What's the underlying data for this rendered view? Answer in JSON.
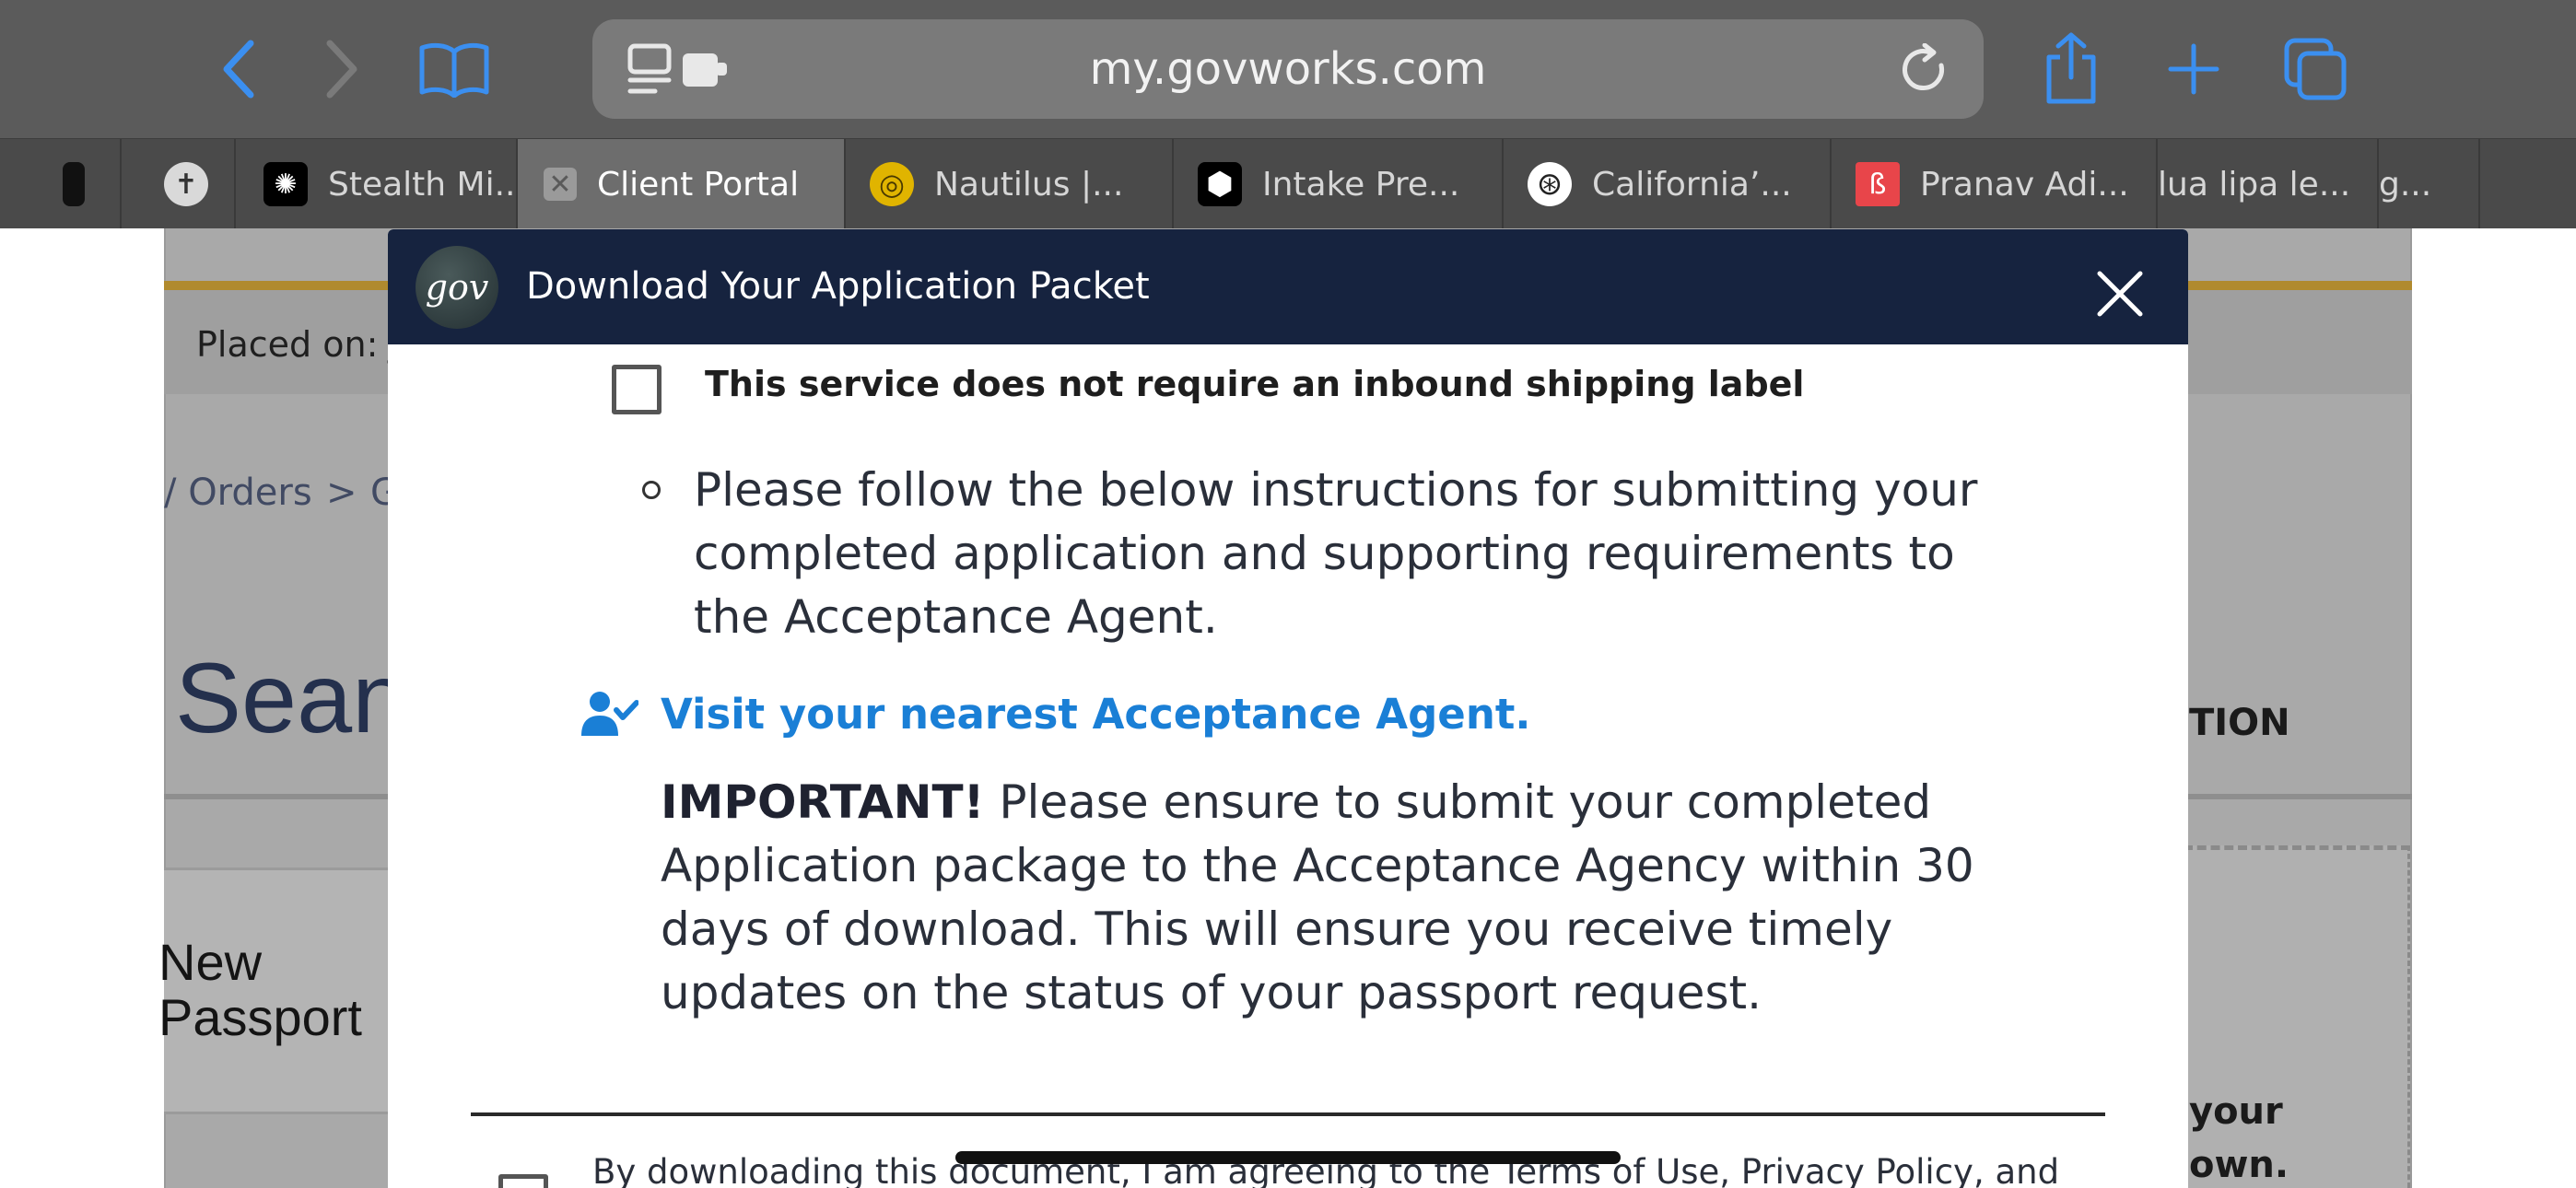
{
  "browser": {
    "url": "my.govworks.com",
    "tabs": [
      {
        "label": "",
        "icon": "dark-favicon"
      },
      {
        "label": "",
        "icon": "cross-favicon"
      },
      {
        "label": "Stealth Mi...",
        "icon": "spider-favicon"
      },
      {
        "label": "Client Portal",
        "icon": "close-icon",
        "active": true
      },
      {
        "label": "Nautilus |...",
        "icon": "spiral-favicon"
      },
      {
        "label": "Intake Pre...",
        "icon": "hexagon-favicon"
      },
      {
        "label": "California’...",
        "icon": "seal-favicon"
      },
      {
        "label": "Pranav Adi...",
        "icon": "red-favicon"
      },
      {
        "label": "lua lipa le...",
        "icon": ""
      },
      {
        "label": "g...",
        "icon": ""
      }
    ]
  },
  "background_page": {
    "placed_on": "Placed on: J",
    "breadcrumb": "/ Orders",
    "breadcrumb_sep": ">",
    "breadcrumb_next": "G",
    "name": "Sean",
    "service_line1": "New",
    "service_line2": "Passport",
    "right_heading": "TION",
    "right_text_line1": "your",
    "right_text_line2": "own."
  },
  "modal": {
    "logo_text": "gov",
    "title": "Download Your Application Packet",
    "shipping_checkbox_label": "This service does not require an inbound shipping label",
    "instructions_line1": "Please follow the below instructions for submitting your",
    "instructions_line2": "completed application and supporting requirements to",
    "instructions_line3": "the Acceptance Agent.",
    "agent_link": "Visit your nearest Acceptance Agent.",
    "important_label": "IMPORTANT!",
    "important_line1": " Please ensure to submit your completed",
    "important_line2": "Application package to the Acceptance Agency within 30",
    "important_line3": "days of download. This will ensure you receive timely",
    "important_line4": "updates on the status of your passport request.",
    "terms_text": "By downloading this document, I am agreeing to the Terms of Use, Privacy Policy, and"
  },
  "colors": {
    "header_bg": "#16233f",
    "link": "#1a7fd6",
    "toolbar_icon": "#3b8ff0"
  }
}
